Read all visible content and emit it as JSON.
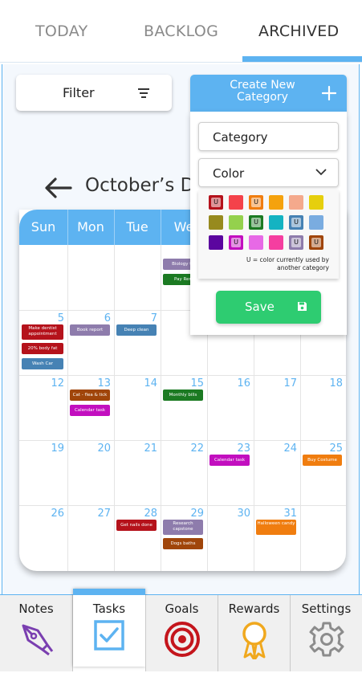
{
  "top_tabs": [
    {
      "label": "TODAY",
      "active": false
    },
    {
      "label": "BACKLOG",
      "active": false
    },
    {
      "label": "ARCHIVED",
      "active": true
    }
  ],
  "filter": {
    "label": "Filter",
    "icon": "filter-icon"
  },
  "calendar": {
    "title": "October’s D",
    "days": [
      "Sun",
      "Mon",
      "Tue",
      "We"
    ],
    "weeks": [
      [
        "",
        "",
        "",
        "",
        "",
        "",
        ""
      ],
      [
        "5",
        "6",
        "7",
        "",
        "",
        "",
        ""
      ],
      [
        "12",
        "13",
        "14",
        "15",
        "16",
        "17",
        "18"
      ],
      [
        "19",
        "20",
        "21",
        "22",
        "23",
        "24",
        "25"
      ],
      [
        "26",
        "27",
        "28",
        "29",
        "30",
        "31",
        ""
      ]
    ],
    "events": [
      {
        "week": 0,
        "day": 3,
        "slot": 0,
        "label": "Biology th",
        "color": "#8e7cac"
      },
      {
        "week": 0,
        "day": 3,
        "slot": 1,
        "label": "Pay Ren",
        "color": "#1b7a22"
      },
      {
        "week": 1,
        "day": 0,
        "slot": 0,
        "label": "Make dentist appointment",
        "color": "#b5121b",
        "tall": true
      },
      {
        "week": 1,
        "day": 0,
        "slot": 1,
        "label": "20% body fat",
        "color": "#b5121b"
      },
      {
        "week": 1,
        "day": 0,
        "slot": 2,
        "label": "Wash Car",
        "color": "#4682b4"
      },
      {
        "week": 1,
        "day": 1,
        "slot": 0,
        "label": "Book report",
        "color": "#8e7cac"
      },
      {
        "week": 1,
        "day": 2,
        "slot": 0,
        "label": "Deep clean",
        "color": "#4682b4"
      },
      {
        "week": 2,
        "day": 1,
        "slot": 0,
        "label": "Cat - flea & tick",
        "color": "#a0450a"
      },
      {
        "week": 2,
        "day": 1,
        "slot": 1,
        "label": "Calendar task",
        "color": "#c20fbf"
      },
      {
        "week": 2,
        "day": 3,
        "slot": 0,
        "label": "Monthly bills",
        "color": "#1b7a22"
      },
      {
        "week": 3,
        "day": 4,
        "slot": 0,
        "label": "Calendar task",
        "color": "#c20fbf"
      },
      {
        "week": 3,
        "day": 6,
        "slot": 0,
        "label": "Buy Costume",
        "color": "#f07d0f"
      },
      {
        "week": 4,
        "day": 2,
        "slot": 0,
        "label": "Get nails done",
        "color": "#b5121b"
      },
      {
        "week": 4,
        "day": 3,
        "slot": 0,
        "label": "Research capstone",
        "color": "#8e7cac",
        "tall": true
      },
      {
        "week": 4,
        "day": 3,
        "slot": 1,
        "label": "Dogs baths",
        "color": "#a0450a"
      },
      {
        "week": 4,
        "day": 5,
        "slot": 0,
        "label": "Halloween candy",
        "color": "#f07d0f",
        "tall": true
      }
    ]
  },
  "create_category": {
    "button_label": "Create New Category",
    "icon": "plus-icon",
    "category_placeholder": "Category",
    "color_label": "Color",
    "swatches": [
      [
        {
          "color": "#b5121b",
          "used": true
        },
        {
          "color": "#f4424a",
          "used": false
        },
        {
          "color": "#f07d0f",
          "used": true
        },
        {
          "color": "#f5a20d",
          "used": false
        },
        {
          "color": "#f4a98c",
          "used": false
        },
        {
          "color": "#e6cf0d",
          "used": false
        }
      ],
      [
        {
          "color": "#978a1e",
          "used": false
        },
        {
          "color": "#94d14d",
          "used": false
        },
        {
          "color": "#1b7a22",
          "used": true
        },
        {
          "color": "#14b3c2",
          "used": false
        },
        {
          "color": "#4682b4",
          "used": true
        },
        {
          "color": "#7aace0",
          "used": false
        }
      ],
      [
        {
          "color": "#5b069f",
          "used": false
        },
        {
          "color": "#c20fbf",
          "used": true
        },
        {
          "color": "#e769e6",
          "used": false
        },
        {
          "color": "#f53ea0",
          "used": false
        },
        {
          "color": "#8e7cac",
          "used": true
        },
        {
          "color": "#a0450a",
          "used": true
        }
      ]
    ],
    "used_marker": "U",
    "legend": "U = color currently used by another category",
    "save_label": "Save",
    "save_icon": "floppy-disk-icon"
  },
  "bottom_nav": [
    {
      "label": "Notes",
      "icon": "pen-nib-icon",
      "active": false
    },
    {
      "label": "Tasks",
      "icon": "checkbox-icon",
      "active": true
    },
    {
      "label": "Goals",
      "icon": "target-icon",
      "active": false
    },
    {
      "label": "Rewards",
      "icon": "award-ribbon-icon",
      "active": false
    },
    {
      "label": "Settings",
      "icon": "gear-icon",
      "active": false
    }
  ],
  "colors": {
    "accent": "#5db3f1",
    "save": "#2ecc71"
  }
}
